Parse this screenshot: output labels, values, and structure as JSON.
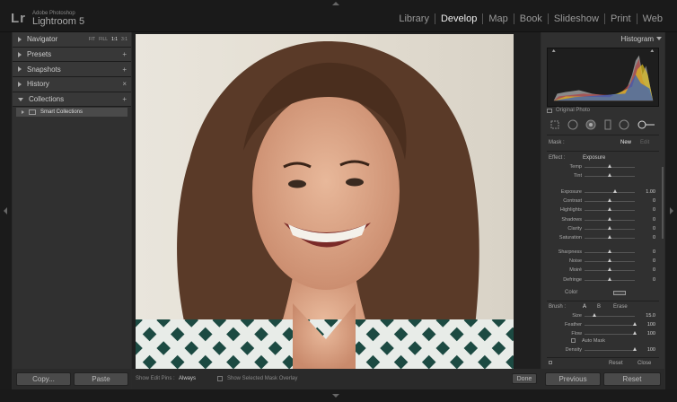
{
  "brand": {
    "sub": "Adobe Photoshop",
    "name": "Lightroom 5",
    "logo": "Lr"
  },
  "modules": [
    {
      "label": "Library"
    },
    {
      "label": "Develop",
      "active": true
    },
    {
      "label": "Map"
    },
    {
      "label": "Book"
    },
    {
      "label": "Slideshow"
    },
    {
      "label": "Print"
    },
    {
      "label": "Web"
    }
  ],
  "left_panel": {
    "navigator": {
      "label": "Navigator",
      "zoom": [
        "FIT",
        "FILL",
        "1:1",
        "3:1"
      ],
      "zoom_selected": "1:1"
    },
    "presets": {
      "label": "Presets",
      "action": "+"
    },
    "snapshots": {
      "label": "Snapshots",
      "action": "+"
    },
    "history": {
      "label": "History",
      "action": "×"
    },
    "collections": {
      "label": "Collections",
      "action": "+",
      "child": "Smart Collections"
    },
    "copy_label": "Copy...",
    "paste_label": "Paste"
  },
  "toolbar": {
    "show_edit_pins": "Show Edit Pins :",
    "pins_value": "Always",
    "show_mask": "Show Selected Mask Overlay",
    "done": "Done"
  },
  "right_panel": {
    "histogram_label": "Histogram",
    "original_photo": "Original Photo",
    "mask_label": "Mask :",
    "mask_new": "New",
    "mask_edit": "Edit",
    "effect_label": "Effect :",
    "effect_value": "Exposure",
    "group1": [
      {
        "label": "Temp",
        "value": "",
        "pos": 0.5
      },
      {
        "label": "Tint",
        "value": "",
        "pos": 0.5
      }
    ],
    "group2": [
      {
        "label": "Exposure",
        "value": "1.00",
        "pos": 0.62
      },
      {
        "label": "Contrast",
        "value": "0",
        "pos": 0.5
      },
      {
        "label": "Highlights",
        "value": "0",
        "pos": 0.5
      },
      {
        "label": "Shadows",
        "value": "0",
        "pos": 0.5
      },
      {
        "label": "Clarity",
        "value": "0",
        "pos": 0.5
      },
      {
        "label": "Saturation",
        "value": "0",
        "pos": 0.5
      }
    ],
    "group3": [
      {
        "label": "Sharpness",
        "value": "0",
        "pos": 0.5
      },
      {
        "label": "Noise",
        "value": "0",
        "pos": 0.5
      },
      {
        "label": "Moiré",
        "value": "0",
        "pos": 0.5
      },
      {
        "label": "Defringe",
        "value": "0",
        "pos": 0.5
      }
    ],
    "color_label": "Color",
    "brush_label": "Brush :",
    "brush_a": "A",
    "brush_b": "B",
    "brush_erase": "Erase",
    "brush": [
      {
        "label": "Size",
        "value": "15.0",
        "pos": 0.2
      },
      {
        "label": "Feather",
        "value": "100",
        "pos": 1.0
      },
      {
        "label": "Flow",
        "value": "100",
        "pos": 1.0
      }
    ],
    "auto_mask": "Auto Mask",
    "density": {
      "label": "Density",
      "value": "100",
      "pos": 1.0
    },
    "reset": "Reset",
    "close": "Close",
    "previous_label": "Previous",
    "reset_label": "Reset"
  }
}
